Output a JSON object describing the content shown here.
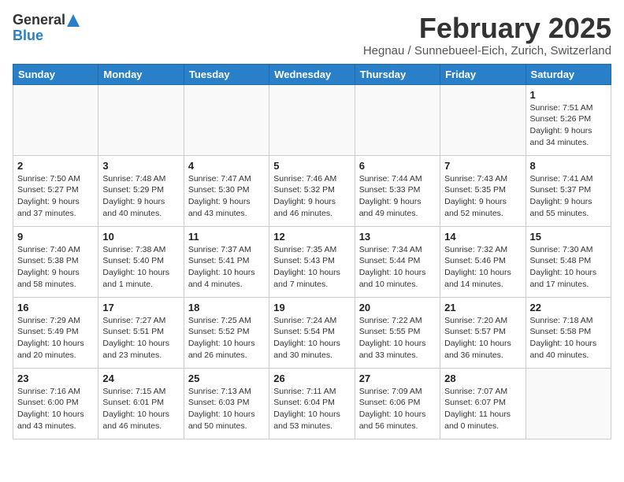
{
  "logo": {
    "line1": "General",
    "line2": "Blue"
  },
  "title": "February 2025",
  "subtitle": "Hegnau / Sunnebueel-Eich, Zurich, Switzerland",
  "headers": [
    "Sunday",
    "Monday",
    "Tuesday",
    "Wednesday",
    "Thursday",
    "Friday",
    "Saturday"
  ],
  "weeks": [
    [
      {
        "day": "",
        "text": ""
      },
      {
        "day": "",
        "text": ""
      },
      {
        "day": "",
        "text": ""
      },
      {
        "day": "",
        "text": ""
      },
      {
        "day": "",
        "text": ""
      },
      {
        "day": "",
        "text": ""
      },
      {
        "day": "1",
        "text": "Sunrise: 7:51 AM\nSunset: 5:26 PM\nDaylight: 9 hours and 34 minutes."
      }
    ],
    [
      {
        "day": "2",
        "text": "Sunrise: 7:50 AM\nSunset: 5:27 PM\nDaylight: 9 hours and 37 minutes."
      },
      {
        "day": "3",
        "text": "Sunrise: 7:48 AM\nSunset: 5:29 PM\nDaylight: 9 hours and 40 minutes."
      },
      {
        "day": "4",
        "text": "Sunrise: 7:47 AM\nSunset: 5:30 PM\nDaylight: 9 hours and 43 minutes."
      },
      {
        "day": "5",
        "text": "Sunrise: 7:46 AM\nSunset: 5:32 PM\nDaylight: 9 hours and 46 minutes."
      },
      {
        "day": "6",
        "text": "Sunrise: 7:44 AM\nSunset: 5:33 PM\nDaylight: 9 hours and 49 minutes."
      },
      {
        "day": "7",
        "text": "Sunrise: 7:43 AM\nSunset: 5:35 PM\nDaylight: 9 hours and 52 minutes."
      },
      {
        "day": "8",
        "text": "Sunrise: 7:41 AM\nSunset: 5:37 PM\nDaylight: 9 hours and 55 minutes."
      }
    ],
    [
      {
        "day": "9",
        "text": "Sunrise: 7:40 AM\nSunset: 5:38 PM\nDaylight: 9 hours and 58 minutes."
      },
      {
        "day": "10",
        "text": "Sunrise: 7:38 AM\nSunset: 5:40 PM\nDaylight: 10 hours and 1 minute."
      },
      {
        "day": "11",
        "text": "Sunrise: 7:37 AM\nSunset: 5:41 PM\nDaylight: 10 hours and 4 minutes."
      },
      {
        "day": "12",
        "text": "Sunrise: 7:35 AM\nSunset: 5:43 PM\nDaylight: 10 hours and 7 minutes."
      },
      {
        "day": "13",
        "text": "Sunrise: 7:34 AM\nSunset: 5:44 PM\nDaylight: 10 hours and 10 minutes."
      },
      {
        "day": "14",
        "text": "Sunrise: 7:32 AM\nSunset: 5:46 PM\nDaylight: 10 hours and 14 minutes."
      },
      {
        "day": "15",
        "text": "Sunrise: 7:30 AM\nSunset: 5:48 PM\nDaylight: 10 hours and 17 minutes."
      }
    ],
    [
      {
        "day": "16",
        "text": "Sunrise: 7:29 AM\nSunset: 5:49 PM\nDaylight: 10 hours and 20 minutes."
      },
      {
        "day": "17",
        "text": "Sunrise: 7:27 AM\nSunset: 5:51 PM\nDaylight: 10 hours and 23 minutes."
      },
      {
        "day": "18",
        "text": "Sunrise: 7:25 AM\nSunset: 5:52 PM\nDaylight: 10 hours and 26 minutes."
      },
      {
        "day": "19",
        "text": "Sunrise: 7:24 AM\nSunset: 5:54 PM\nDaylight: 10 hours and 30 minutes."
      },
      {
        "day": "20",
        "text": "Sunrise: 7:22 AM\nSunset: 5:55 PM\nDaylight: 10 hours and 33 minutes."
      },
      {
        "day": "21",
        "text": "Sunrise: 7:20 AM\nSunset: 5:57 PM\nDaylight: 10 hours and 36 minutes."
      },
      {
        "day": "22",
        "text": "Sunrise: 7:18 AM\nSunset: 5:58 PM\nDaylight: 10 hours and 40 minutes."
      }
    ],
    [
      {
        "day": "23",
        "text": "Sunrise: 7:16 AM\nSunset: 6:00 PM\nDaylight: 10 hours and 43 minutes."
      },
      {
        "day": "24",
        "text": "Sunrise: 7:15 AM\nSunset: 6:01 PM\nDaylight: 10 hours and 46 minutes."
      },
      {
        "day": "25",
        "text": "Sunrise: 7:13 AM\nSunset: 6:03 PM\nDaylight: 10 hours and 50 minutes."
      },
      {
        "day": "26",
        "text": "Sunrise: 7:11 AM\nSunset: 6:04 PM\nDaylight: 10 hours and 53 minutes."
      },
      {
        "day": "27",
        "text": "Sunrise: 7:09 AM\nSunset: 6:06 PM\nDaylight: 10 hours and 56 minutes."
      },
      {
        "day": "28",
        "text": "Sunrise: 7:07 AM\nSunset: 6:07 PM\nDaylight: 11 hours and 0 minutes."
      },
      {
        "day": "",
        "text": ""
      }
    ]
  ]
}
